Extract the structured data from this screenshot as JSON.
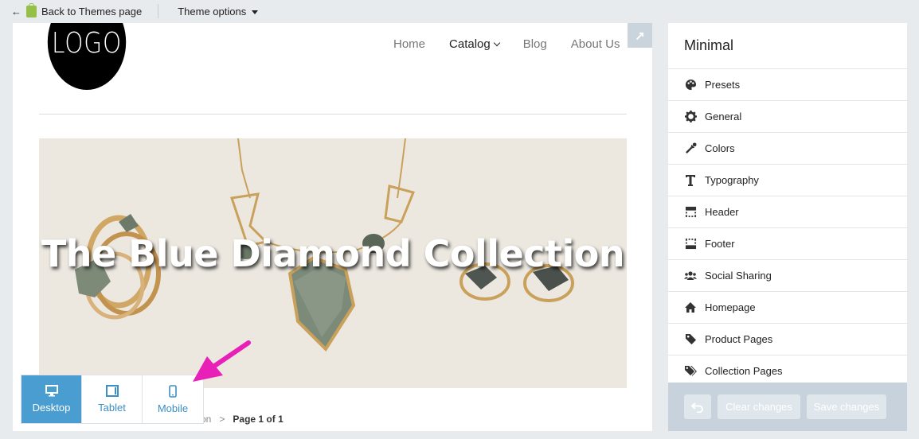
{
  "topbar": {
    "back_label": "Back to Themes page",
    "theme_options_label": "Theme options"
  },
  "preview": {
    "logo_text": "LOGO",
    "nav": [
      {
        "label": "Home"
      },
      {
        "label": "Catalog"
      },
      {
        "label": "Blog"
      },
      {
        "label": "About Us"
      }
    ],
    "hero_title": "The Blue Diamond Collection",
    "breadcrumb_partial": "on",
    "breadcrumb_sep": ">",
    "breadcrumb_page": "Page 1 of 1"
  },
  "devices": [
    {
      "label": "Desktop",
      "icon": "desktop-icon",
      "active": true
    },
    {
      "label": "Tablet",
      "icon": "tablet-icon",
      "active": false
    },
    {
      "label": "Mobile",
      "icon": "mobile-icon",
      "active": false
    }
  ],
  "panel": {
    "title": "Minimal",
    "items": [
      {
        "label": "Presets",
        "icon": "palette-icon"
      },
      {
        "label": "General",
        "icon": "gear-icon"
      },
      {
        "label": "Colors",
        "icon": "eyedropper-icon"
      },
      {
        "label": "Typography",
        "icon": "typography-icon"
      },
      {
        "label": "Header",
        "icon": "header-icon"
      },
      {
        "label": "Footer",
        "icon": "footer-icon"
      },
      {
        "label": "Social Sharing",
        "icon": "users-icon"
      },
      {
        "label": "Homepage",
        "icon": "home-icon"
      },
      {
        "label": "Product Pages",
        "icon": "tag-icon"
      },
      {
        "label": "Collection Pages",
        "icon": "tags-icon"
      }
    ],
    "clear_label": "Clear changes",
    "save_label": "Save changes"
  },
  "colors": {
    "accent": "#4a9dd1",
    "pointer": "#e820b8",
    "footer_bg": "#c7d2dc"
  }
}
